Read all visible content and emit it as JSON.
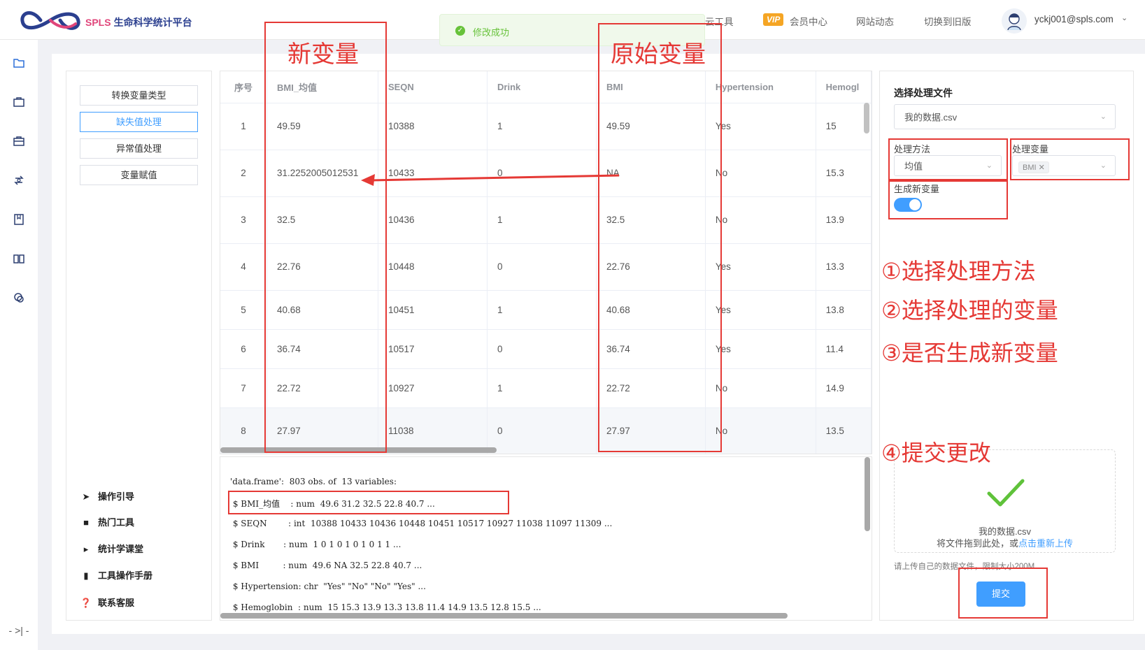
{
  "header": {
    "brand_en": "SPLS",
    "brand_cn": "生命科学统计平台",
    "nav": [
      "云工具",
      "会员中心",
      "网站动态",
      "切换到旧版"
    ],
    "vip_badge": "VIP",
    "user": "yckj001@spls.com"
  },
  "toast": {
    "message": "修改成功"
  },
  "sidebar_icons": [
    "folder-icon",
    "briefcase-icon",
    "toolbox-icon",
    "transform-icon",
    "book-mark-icon",
    "open-book-icon",
    "chat-icon"
  ],
  "collapse_label": "- >| -",
  "menu": {
    "buttons": [
      "转换变量类型",
      "缺失值处理",
      "异常值处理",
      "变量赋值"
    ],
    "active_index": 1,
    "links": [
      "操作引导",
      "热门工具",
      "统计学课堂",
      "工具操作手册",
      "联系客服"
    ]
  },
  "table": {
    "columns": [
      "序号",
      "BMI_均值",
      "SEQN",
      "Drink",
      "BMI",
      "Hypertension",
      "Hemogl"
    ],
    "rows": [
      [
        "1",
        "49.59",
        "10388",
        "1",
        "49.59",
        "Yes",
        "15"
      ],
      [
        "2",
        "31.2252005012531",
        "10433",
        "0",
        "NA",
        "No",
        "15.3"
      ],
      [
        "3",
        "32.5",
        "10436",
        "1",
        "32.5",
        "No",
        "13.9"
      ],
      [
        "4",
        "22.76",
        "10448",
        "0",
        "22.76",
        "Yes",
        "13.3"
      ],
      [
        "5",
        "40.68",
        "10451",
        "1",
        "40.68",
        "Yes",
        "13.8"
      ],
      [
        "6",
        "36.74",
        "10517",
        "0",
        "36.74",
        "Yes",
        "11.4"
      ],
      [
        "7",
        "22.72",
        "10927",
        "1",
        "22.72",
        "No",
        "14.9"
      ],
      [
        "8",
        "27.97",
        "11038",
        "0",
        "27.97",
        "No",
        "13.5"
      ]
    ]
  },
  "console": {
    "lines": [
      "'data.frame':  803 obs. of  13 variables:",
      " $ BMI_均值    : num  49.6 31.2 32.5 22.8 40.7 ...",
      " $ SEQN        : int  10388 10433 10436 10448 10451 10517 10927 11038 11097 11309 ...",
      " $ Drink       : num  1 0 1 0 1 0 1 0 1 1 ...",
      " $ BMI         : num  49.6 NA 32.5 22.8 40.7 ...",
      " $ Hypertension: chr  \"Yes\" \"No\" \"No\" \"Yes\" ...",
      " $ Hemoglobin  : num  15 15.3 13.9 13.3 13.8 11.4 14.9 13.5 12.8 15.5 ..."
    ]
  },
  "right_panel": {
    "title": "选择处理文件",
    "file_value": "我的数据.csv",
    "method_label": "处理方法",
    "method_value": "均值",
    "variable_label": "处理变量",
    "variable_tag": "BMI",
    "newvar_label": "生成新变量",
    "newvar_on": true,
    "upload_filename": "我的数据.csv",
    "upload_hint": "将文件拖到此处，或",
    "upload_link": "点击重新上传",
    "upload_limit": "请上传自己的数据文件，限制大小200M",
    "submit_label": "提交"
  },
  "annotations": {
    "new_var": "新变量",
    "orig_var": "原始变量",
    "step1": "①选择处理方法",
    "step2": "②选择处理的变量",
    "step3": "③是否生成新变量",
    "step4": "④提交更改",
    "color": "#e53935"
  },
  "colors": {
    "accent": "#409eff",
    "success": "#67c23a",
    "vip": "#f5a524",
    "annotation": "#e53935"
  }
}
